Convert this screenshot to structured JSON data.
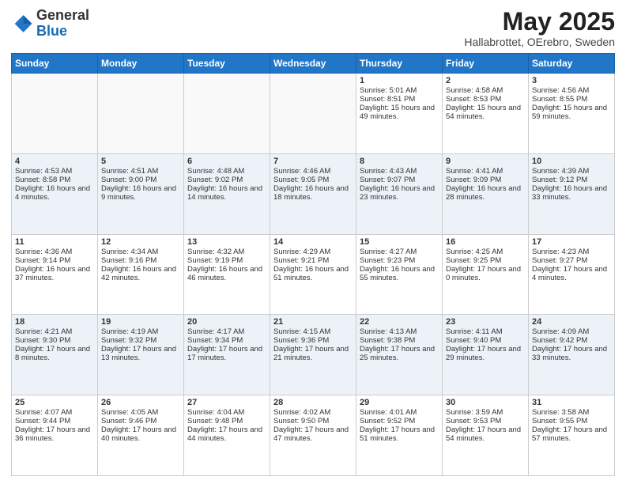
{
  "header": {
    "logo_general": "General",
    "logo_blue": "Blue",
    "month_year": "May 2025",
    "location": "Hallabrottet, OErebro, Sweden"
  },
  "days_of_week": [
    "Sunday",
    "Monday",
    "Tuesday",
    "Wednesday",
    "Thursday",
    "Friday",
    "Saturday"
  ],
  "weeks": [
    [
      {
        "day": "",
        "sunrise": "",
        "sunset": "",
        "daylight": ""
      },
      {
        "day": "",
        "sunrise": "",
        "sunset": "",
        "daylight": ""
      },
      {
        "day": "",
        "sunrise": "",
        "sunset": "",
        "daylight": ""
      },
      {
        "day": "",
        "sunrise": "",
        "sunset": "",
        "daylight": ""
      },
      {
        "day": "1",
        "sunrise": "Sunrise: 5:01 AM",
        "sunset": "Sunset: 8:51 PM",
        "daylight": "Daylight: 15 hours and 49 minutes."
      },
      {
        "day": "2",
        "sunrise": "Sunrise: 4:58 AM",
        "sunset": "Sunset: 8:53 PM",
        "daylight": "Daylight: 15 hours and 54 minutes."
      },
      {
        "day": "3",
        "sunrise": "Sunrise: 4:56 AM",
        "sunset": "Sunset: 8:55 PM",
        "daylight": "Daylight: 15 hours and 59 minutes."
      }
    ],
    [
      {
        "day": "4",
        "sunrise": "Sunrise: 4:53 AM",
        "sunset": "Sunset: 8:58 PM",
        "daylight": "Daylight: 16 hours and 4 minutes."
      },
      {
        "day": "5",
        "sunrise": "Sunrise: 4:51 AM",
        "sunset": "Sunset: 9:00 PM",
        "daylight": "Daylight: 16 hours and 9 minutes."
      },
      {
        "day": "6",
        "sunrise": "Sunrise: 4:48 AM",
        "sunset": "Sunset: 9:02 PM",
        "daylight": "Daylight: 16 hours and 14 minutes."
      },
      {
        "day": "7",
        "sunrise": "Sunrise: 4:46 AM",
        "sunset": "Sunset: 9:05 PM",
        "daylight": "Daylight: 16 hours and 18 minutes."
      },
      {
        "day": "8",
        "sunrise": "Sunrise: 4:43 AM",
        "sunset": "Sunset: 9:07 PM",
        "daylight": "Daylight: 16 hours and 23 minutes."
      },
      {
        "day": "9",
        "sunrise": "Sunrise: 4:41 AM",
        "sunset": "Sunset: 9:09 PM",
        "daylight": "Daylight: 16 hours and 28 minutes."
      },
      {
        "day": "10",
        "sunrise": "Sunrise: 4:39 AM",
        "sunset": "Sunset: 9:12 PM",
        "daylight": "Daylight: 16 hours and 33 minutes."
      }
    ],
    [
      {
        "day": "11",
        "sunrise": "Sunrise: 4:36 AM",
        "sunset": "Sunset: 9:14 PM",
        "daylight": "Daylight: 16 hours and 37 minutes."
      },
      {
        "day": "12",
        "sunrise": "Sunrise: 4:34 AM",
        "sunset": "Sunset: 9:16 PM",
        "daylight": "Daylight: 16 hours and 42 minutes."
      },
      {
        "day": "13",
        "sunrise": "Sunrise: 4:32 AM",
        "sunset": "Sunset: 9:19 PM",
        "daylight": "Daylight: 16 hours and 46 minutes."
      },
      {
        "day": "14",
        "sunrise": "Sunrise: 4:29 AM",
        "sunset": "Sunset: 9:21 PM",
        "daylight": "Daylight: 16 hours and 51 minutes."
      },
      {
        "day": "15",
        "sunrise": "Sunrise: 4:27 AM",
        "sunset": "Sunset: 9:23 PM",
        "daylight": "Daylight: 16 hours and 55 minutes."
      },
      {
        "day": "16",
        "sunrise": "Sunrise: 4:25 AM",
        "sunset": "Sunset: 9:25 PM",
        "daylight": "Daylight: 17 hours and 0 minutes."
      },
      {
        "day": "17",
        "sunrise": "Sunrise: 4:23 AM",
        "sunset": "Sunset: 9:27 PM",
        "daylight": "Daylight: 17 hours and 4 minutes."
      }
    ],
    [
      {
        "day": "18",
        "sunrise": "Sunrise: 4:21 AM",
        "sunset": "Sunset: 9:30 PM",
        "daylight": "Daylight: 17 hours and 8 minutes."
      },
      {
        "day": "19",
        "sunrise": "Sunrise: 4:19 AM",
        "sunset": "Sunset: 9:32 PM",
        "daylight": "Daylight: 17 hours and 13 minutes."
      },
      {
        "day": "20",
        "sunrise": "Sunrise: 4:17 AM",
        "sunset": "Sunset: 9:34 PM",
        "daylight": "Daylight: 17 hours and 17 minutes."
      },
      {
        "day": "21",
        "sunrise": "Sunrise: 4:15 AM",
        "sunset": "Sunset: 9:36 PM",
        "daylight": "Daylight: 17 hours and 21 minutes."
      },
      {
        "day": "22",
        "sunrise": "Sunrise: 4:13 AM",
        "sunset": "Sunset: 9:38 PM",
        "daylight": "Daylight: 17 hours and 25 minutes."
      },
      {
        "day": "23",
        "sunrise": "Sunrise: 4:11 AM",
        "sunset": "Sunset: 9:40 PM",
        "daylight": "Daylight: 17 hours and 29 minutes."
      },
      {
        "day": "24",
        "sunrise": "Sunrise: 4:09 AM",
        "sunset": "Sunset: 9:42 PM",
        "daylight": "Daylight: 17 hours and 33 minutes."
      }
    ],
    [
      {
        "day": "25",
        "sunrise": "Sunrise: 4:07 AM",
        "sunset": "Sunset: 9:44 PM",
        "daylight": "Daylight: 17 hours and 36 minutes."
      },
      {
        "day": "26",
        "sunrise": "Sunrise: 4:05 AM",
        "sunset": "Sunset: 9:46 PM",
        "daylight": "Daylight: 17 hours and 40 minutes."
      },
      {
        "day": "27",
        "sunrise": "Sunrise: 4:04 AM",
        "sunset": "Sunset: 9:48 PM",
        "daylight": "Daylight: 17 hours and 44 minutes."
      },
      {
        "day": "28",
        "sunrise": "Sunrise: 4:02 AM",
        "sunset": "Sunset: 9:50 PM",
        "daylight": "Daylight: 17 hours and 47 minutes."
      },
      {
        "day": "29",
        "sunrise": "Sunrise: 4:01 AM",
        "sunset": "Sunset: 9:52 PM",
        "daylight": "Daylight: 17 hours and 51 minutes."
      },
      {
        "day": "30",
        "sunrise": "Sunrise: 3:59 AM",
        "sunset": "Sunset: 9:53 PM",
        "daylight": "Daylight: 17 hours and 54 minutes."
      },
      {
        "day": "31",
        "sunrise": "Sunrise: 3:58 AM",
        "sunset": "Sunset: 9:55 PM",
        "daylight": "Daylight: 17 hours and 57 minutes."
      }
    ]
  ]
}
